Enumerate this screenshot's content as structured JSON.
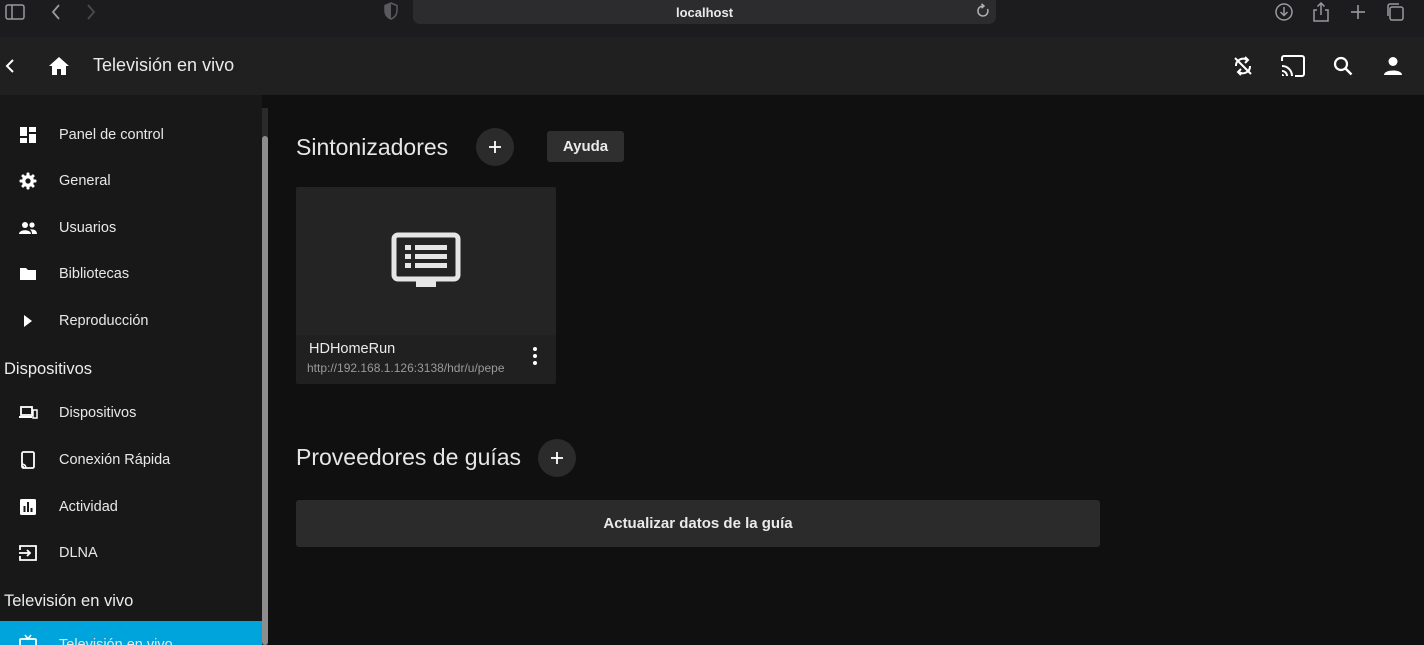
{
  "browser": {
    "url": "localhost",
    "icons": [
      "sidebar-icon",
      "back-icon",
      "forward-icon",
      "shield-icon",
      "reload-icon",
      "download-icon",
      "share-icon",
      "new-tab-icon",
      "tabs-overview-icon"
    ]
  },
  "header": {
    "title": "Televisión en vivo",
    "icons": [
      "back-arrow-icon",
      "home-icon",
      "sync-disabled-icon",
      "cast-icon",
      "search-icon",
      "user-icon"
    ]
  },
  "sidebar": {
    "items": [
      {
        "label": "Panel de control",
        "icon": "dashboard-icon"
      },
      {
        "label": "General",
        "icon": "gear-icon"
      },
      {
        "label": "Usuarios",
        "icon": "users-icon"
      },
      {
        "label": "Bibliotecas",
        "icon": "folder-icon"
      },
      {
        "label": "Reproducción",
        "icon": "play-icon"
      }
    ],
    "section_devices": "Dispositivos",
    "device_items": [
      {
        "label": "Dispositivos",
        "icon": "devices-icon"
      },
      {
        "label": "Conexión Rápida",
        "icon": "quick-connect-icon"
      },
      {
        "label": "Actividad",
        "icon": "activity-icon"
      },
      {
        "label": "DLNA",
        "icon": "dlna-icon"
      }
    ],
    "section_live": "Televisión en vivo",
    "live_items": [
      {
        "label": "Televisión en vivo",
        "icon": "live-tv-icon",
        "active": true
      }
    ]
  },
  "main": {
    "tuners_title": "Sintonizadores",
    "help_label": "Ayuda",
    "tuner_card": {
      "title": "HDHomeRun",
      "subtitle": "http://192.168.1.126:3138/hdr/u/pepe",
      "icon": "tuner-device-icon"
    },
    "guide_title": "Proveedores de guías",
    "refresh_label": "Actualizar datos de la guía"
  },
  "colors": {
    "accent": "#00a4dc",
    "background": "#101010",
    "header": "#202020",
    "sidebar": "#181818"
  }
}
